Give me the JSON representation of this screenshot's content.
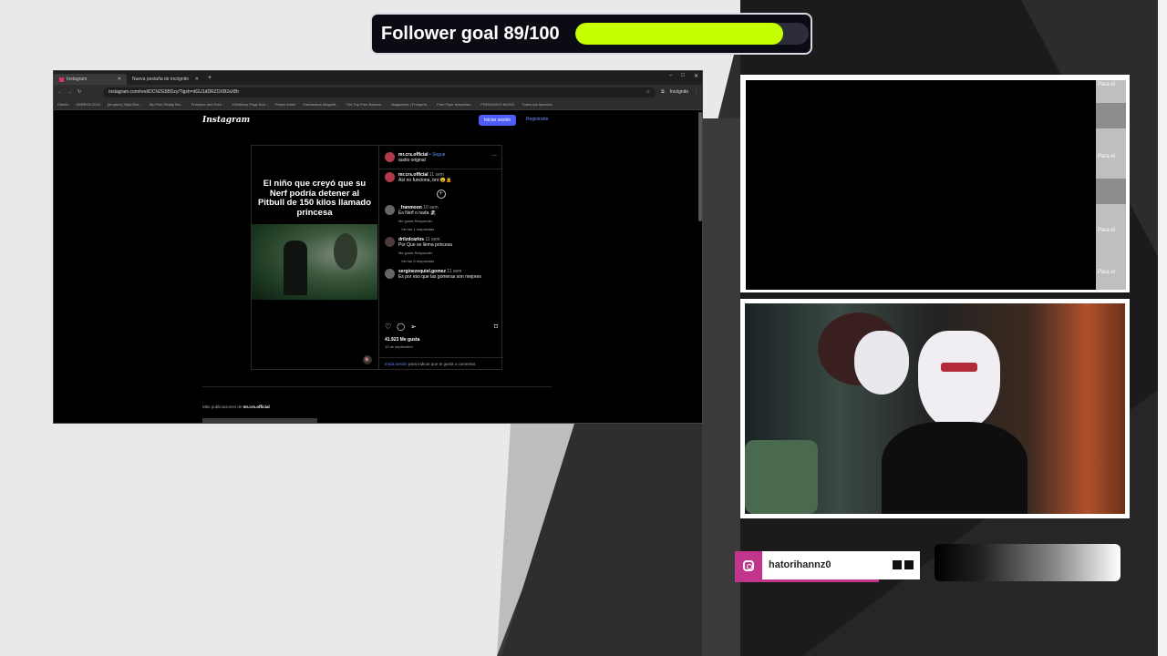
{
  "goal": {
    "text": "Follower goal 89/100",
    "current": 89,
    "target": 100,
    "fill_color": "#c6ff00"
  },
  "browser": {
    "tabs": [
      "Instagram",
      "Nueva pestaña de incógnito"
    ],
    "url": "instagram.com/reel/DCN2G5BDzy/?igsh=dGU1dDRZOXB2aXBr",
    "incognito_label": "Incógnito",
    "bookmarks": [
      "Diseño",
      "DEBRO2.2024",
      "[dropbox] High-Res...",
      "My Print Ready Bro...",
      "Premium and Free...",
      "X/Wisbury Page Buil...",
      "Power folder",
      "Fantásticos Magnéti...",
      "The Top Free Backea...",
      "Magazines | Portaprin...",
      "Free Flyer templates...",
      "FREEAUDIO MUSIC",
      "Todos los favoritos"
    ]
  },
  "instagram": {
    "logo": "Instagram",
    "login_button": "Iniciar sesión",
    "register_link": "Registrarte",
    "media_caption": "El niño que creyó que su Nerf podría detener al Pitbull de 150 kilos llamado princesa",
    "post_author": "mr.crs.official",
    "follow_label": "• Seguir",
    "audio": "audio original",
    "caption_author": "mr.crs.official",
    "caption_age": "11 sem",
    "caption_text": "Así no funciona, bro 😮🤦",
    "comments": [
      {
        "user": "_franmoon",
        "age": "10 sem",
        "text": "Es Nerf o nada 🏖",
        "meta": "Me gusta   Responder",
        "replies": "Ver las 1 respuestas"
      },
      {
        "user": "drilzdcarlos",
        "age": "11 sem",
        "text": "Por Que se llema princesa",
        "meta": "Me gusta   Responder",
        "replies": "Ver las 5 respuestas"
      },
      {
        "user": "sergioezequiel.gomez",
        "age": "11 sem",
        "text": "Es por eso que las gomeras son mejores",
        "meta": "",
        "replies": ""
      }
    ],
    "likes": "41.923 Me gusta",
    "date": "12 de septiembre",
    "login_prompt_link": "Inicia sesión",
    "login_prompt_text": " para indicar que te gusta o comentar.",
    "more_posts_prefix": "Más publicaciones de ",
    "more_posts_user": "mr.crs.official"
  },
  "side_strip": {
    "label": "Para el"
  },
  "handle": {
    "username": "hatorihannz0",
    "icon": "instagram-icon",
    "accent": "#c1358c"
  }
}
